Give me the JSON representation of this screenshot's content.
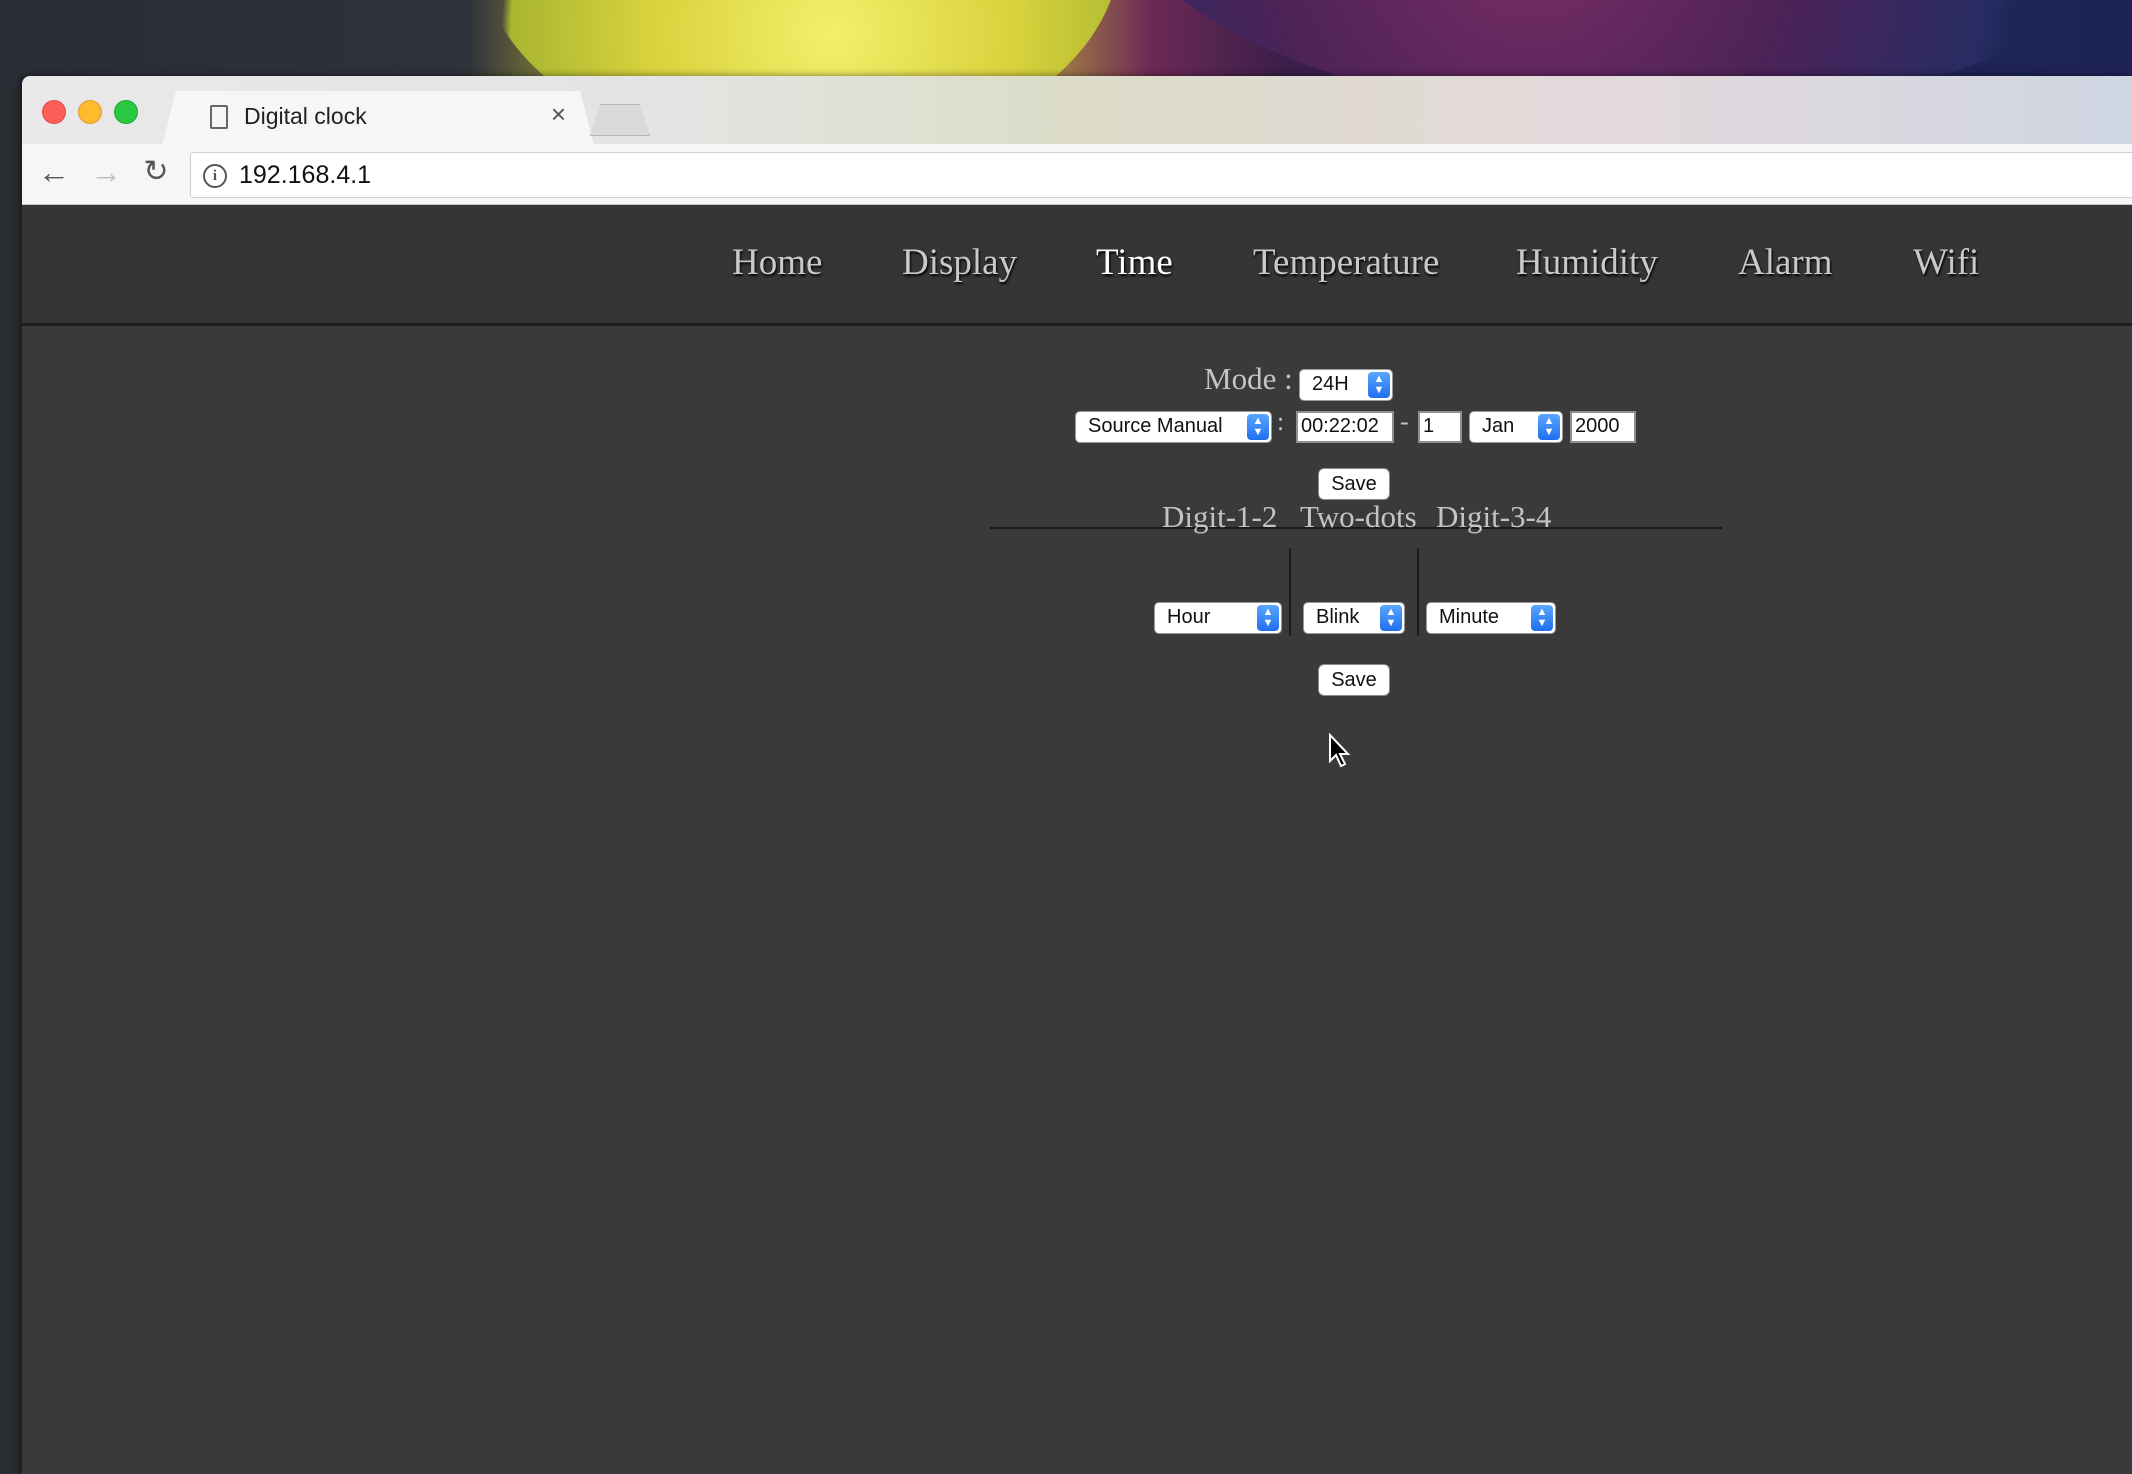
{
  "browser": {
    "tab_title": "Digital clock",
    "tab_close": "×",
    "url": "192.168.4.1",
    "info_icon": "i"
  },
  "menu": {
    "items": [
      "Home",
      "Display",
      "Time",
      "Temperature",
      "Humidity",
      "Alarm",
      "Wifi"
    ],
    "active": "Time"
  },
  "time_form": {
    "mode_label": "Mode :",
    "mode_value": "24H",
    "source_value": "Source Manual",
    "colon": ":",
    "time_value": "00:22:02",
    "dash": "-",
    "day_value": "1",
    "month_value": "Jan",
    "year_value": "2000",
    "save_label": "Save"
  },
  "digit_form": {
    "col1_label": "Digit-1-2",
    "col1_value": "Hour",
    "col2_label": "Two-dots",
    "col2_value": "Blink",
    "col3_label": "Digit-3-4",
    "col3_value": "Minute",
    "save_label": "Save"
  },
  "colors": {
    "page_bg": "#3a3a3a",
    "menu_bg": "#353535",
    "select_arrow": "#1f6ff0"
  }
}
